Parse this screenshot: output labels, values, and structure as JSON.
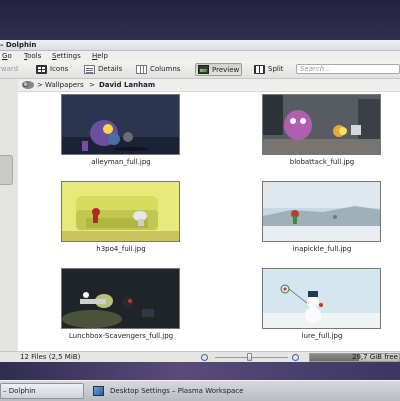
{
  "window": {
    "title": "– Dolphin"
  },
  "menu": [
    {
      "label": "Go",
      "u": "G",
      "rest": "o"
    },
    {
      "label": "Tools",
      "u": "T",
      "rest": "ools"
    },
    {
      "label": "Settings",
      "u": "S",
      "rest": "ettings"
    },
    {
      "label": "Help",
      "u": "H",
      "rest": "elp"
    }
  ],
  "toolbar": {
    "back_label": "rward",
    "icons_label": "Icons",
    "details_label": "Details",
    "columns_label": "Columns",
    "preview_label": "Preview",
    "split_label": "Split",
    "search_placeholder": "Search..."
  },
  "breadcrumb": {
    "sep": ">",
    "items": [
      "Wallpapers",
      "David Lanham"
    ]
  },
  "files": [
    {
      "name": "alleyman_full.jpg"
    },
    {
      "name": "blobattack_full.jpg"
    },
    {
      "name": "h3po4_full.jpg"
    },
    {
      "name": "inapickle_full.jpg"
    },
    {
      "name": "Lunchbox-Scavengers_full.jpg"
    },
    {
      "name": "lure_full.jpg"
    }
  ],
  "status": {
    "text": "12 Files (2,5 MiB)",
    "free_space": "29,7 GiB free",
    "disk_used_fraction": 0.55
  },
  "taskbar": [
    {
      "label": "– Dolphin"
    },
    {
      "label": "Desktop Settings – Plasma Workspace"
    }
  ]
}
